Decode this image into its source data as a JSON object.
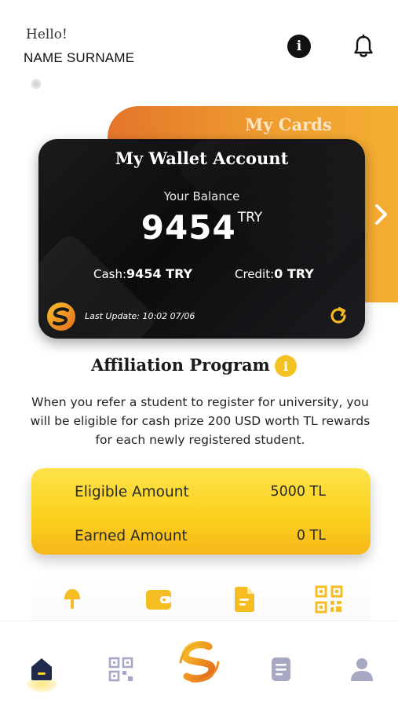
{
  "header": {
    "greeting": "Hello!",
    "user_name": "NAME SURNAME",
    "info_icon": "info-icon",
    "bell_icon": "bell-icon"
  },
  "my_cards": {
    "title": "My Cards",
    "next_icon": "chevron-right-icon"
  },
  "wallet": {
    "title": "My Wallet Account",
    "balance_label": "Your Balance",
    "balance_value": "9454",
    "balance_currency": "TRY",
    "cash_label": "Cash:",
    "cash_value": "9454 TRY",
    "credit_label": "Credit:",
    "credit_value": "0 TRY",
    "last_update": "Last Update: 10:02 07/06",
    "refresh_icon": "refresh-icon"
  },
  "affiliation": {
    "title": "Affiliation Program",
    "description": "When you refer a student to register for university, you will be eligible for cash prize 200 USD worth TL rewards for each newly registered student.",
    "eligible_label": "Eligible Amount",
    "eligible_value": "5000 TL",
    "earned_label": "Earned Amount",
    "earned_value": "0 TL"
  },
  "shortcuts": [
    {
      "icon": "lamp-icon"
    },
    {
      "icon": "wallet-icon"
    },
    {
      "icon": "document-icon"
    },
    {
      "icon": "qr-code-icon"
    }
  ],
  "bottom_nav": [
    {
      "icon": "home-icon",
      "active": true
    },
    {
      "icon": "qr-code-icon"
    },
    {
      "icon": "brand-logo-icon"
    },
    {
      "icon": "document-icon"
    },
    {
      "icon": "profile-icon"
    }
  ],
  "colors": {
    "accent_yellow": "#fbd21e",
    "accent_orange": "#e4752a",
    "nav_inactive": "#a7a9c4",
    "nav_active": "#1f2a4d"
  }
}
